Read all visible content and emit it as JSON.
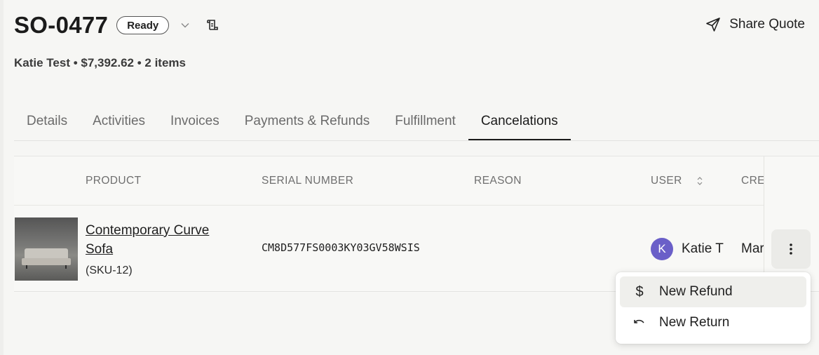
{
  "header": {
    "order_id": "SO-0477",
    "status": "Ready",
    "share_label": "Share Quote"
  },
  "summary": {
    "text": "Katie Test • $7,392.62 • 2 items"
  },
  "tabs": [
    {
      "label": "Details"
    },
    {
      "label": "Activities"
    },
    {
      "label": "Invoices"
    },
    {
      "label": "Payments & Refunds"
    },
    {
      "label": "Fulfillment"
    },
    {
      "label": "Cancelations",
      "active": true
    }
  ],
  "table": {
    "columns": {
      "product": "PRODUCT",
      "serial": "SERIAL NUMBER",
      "reason": "REASON",
      "user": "USER",
      "created": "CRE"
    },
    "rows": [
      {
        "product_name": "Contemporary Curve Sofa",
        "sku": "(SKU-12)",
        "serial": "CM8D577FS0003KY03GV58WSIS",
        "reason": "",
        "user_initial": "K",
        "user_name": "Katie T",
        "created": "Mar"
      }
    ]
  },
  "menu": {
    "items": [
      {
        "icon": "dollar-icon",
        "label": "New Refund"
      },
      {
        "icon": "undo-icon",
        "label": "New Return"
      }
    ]
  },
  "colors": {
    "avatar": "#6a5fc8",
    "background": "#f6f6f4"
  }
}
